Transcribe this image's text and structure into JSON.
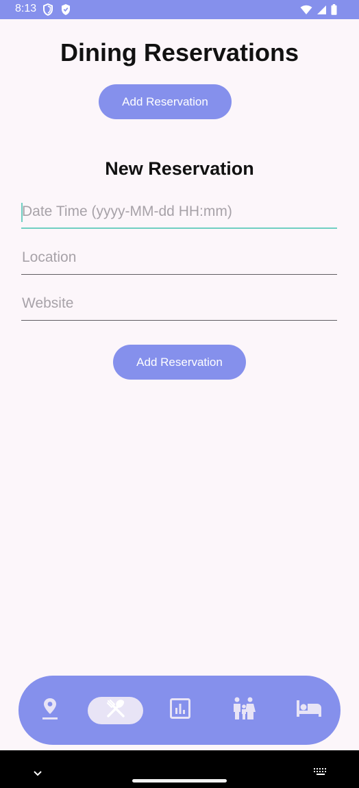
{
  "status_bar": {
    "time": "8:13",
    "icons": [
      "shield-outline-icon",
      "shield-check-icon",
      "wifi-icon",
      "cellular-signal-icon",
      "battery-icon"
    ]
  },
  "page": {
    "title": "Dining Reservations",
    "top_button_label": "Add Reservation"
  },
  "form": {
    "title": "New Reservation",
    "fields": [
      {
        "name": "date-time",
        "placeholder": "Date Time (yyyy-MM-dd HH:mm)",
        "value": "",
        "focused": true
      },
      {
        "name": "location",
        "placeholder": "Location",
        "value": "",
        "focused": false
      },
      {
        "name": "website",
        "placeholder": "Website",
        "value": "",
        "focused": false
      }
    ],
    "submit_label": "Add Reservation"
  },
  "bottom_nav": {
    "items": [
      {
        "icon": "location-pin-icon",
        "selected": false
      },
      {
        "icon": "fork-knife-icon",
        "selected": true
      },
      {
        "icon": "bar-chart-icon",
        "selected": false
      },
      {
        "icon": "family-icon",
        "selected": false
      },
      {
        "icon": "bed-icon",
        "selected": false
      }
    ]
  },
  "system_nav": {
    "icons": [
      "chevron-down-icon",
      "keyboard-icon"
    ]
  },
  "colors": {
    "accent": "#8590ec",
    "background": "#fcf6fa",
    "focus": "#6fcfc2",
    "nav_selected": "#e8e4f6"
  }
}
